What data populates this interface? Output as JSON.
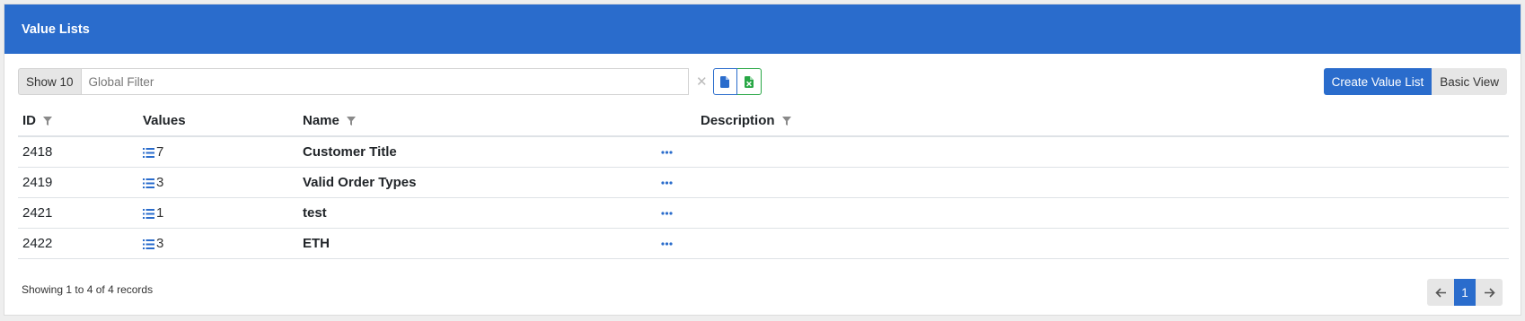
{
  "header": {
    "title": "Value Lists"
  },
  "toolbar": {
    "show_label": "Show 10",
    "filter_placeholder": "Global Filter",
    "clear_icon": "close-icon",
    "pdf_icon": "file-icon",
    "excel_icon": "excel-icon",
    "create_label": "Create Value List",
    "basic_view_label": "Basic View"
  },
  "table": {
    "columns": [
      {
        "label": "ID",
        "filter": true
      },
      {
        "label": "Values",
        "filter": false
      },
      {
        "label": "Name",
        "filter": true
      },
      {
        "label": "",
        "filter": false
      },
      {
        "label": "Description",
        "filter": true
      }
    ],
    "rows": [
      {
        "id": "2418",
        "values": "7",
        "name": "Customer Title",
        "description": ""
      },
      {
        "id": "2419",
        "values": "3",
        "name": "Valid Order Types",
        "description": ""
      },
      {
        "id": "2421",
        "values": "1",
        "name": "test",
        "description": ""
      },
      {
        "id": "2422",
        "values": "3",
        "name": "ETH",
        "description": ""
      }
    ]
  },
  "footer": {
    "info": "Showing 1 to 4 of 4 records",
    "current_page": "1"
  },
  "colors": {
    "primary": "#2a6ccc",
    "success": "#28a745"
  }
}
